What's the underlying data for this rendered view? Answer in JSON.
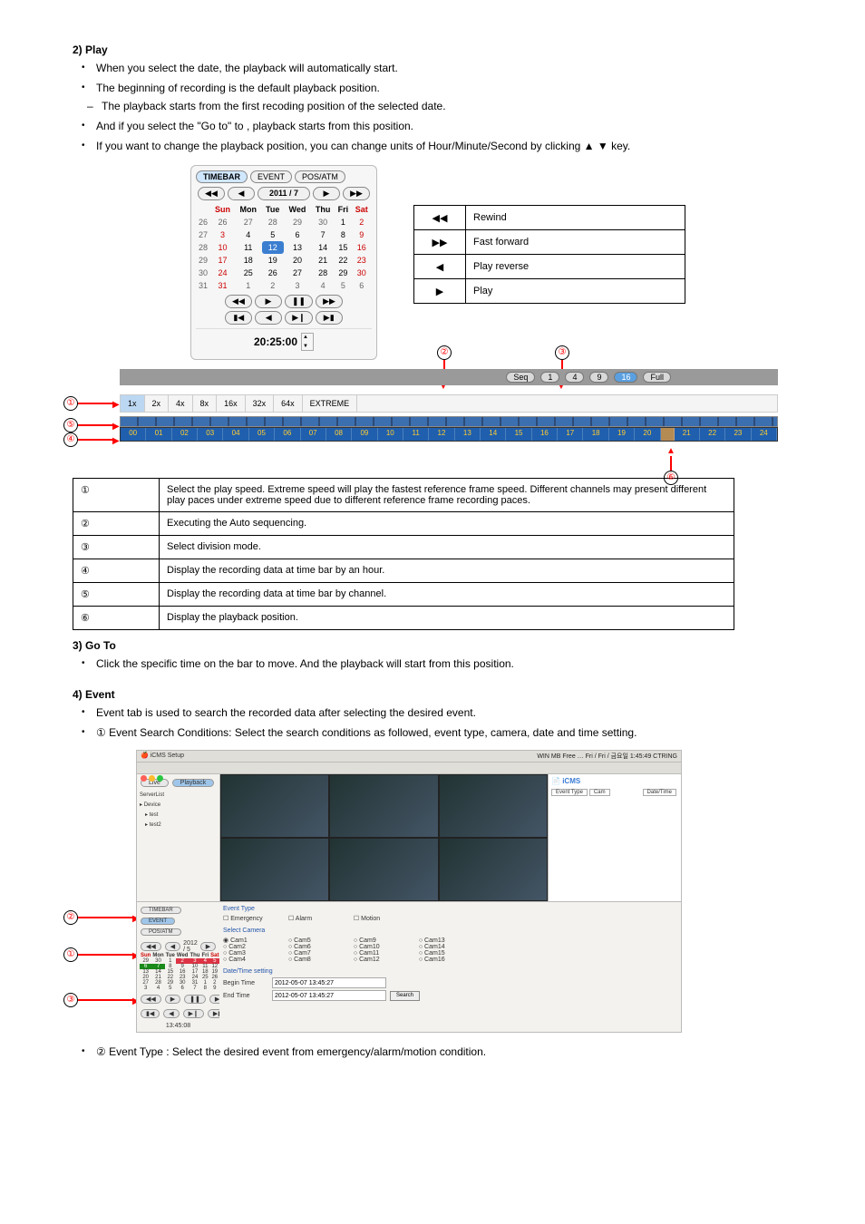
{
  "section1": {
    "title": "2) Play",
    "bullets": [
      "When you select the date, the playback will automatically start.",
      "The beginning of recording is the default playback position.",
      "If you want to change the playback position, you can change units of Hour/Minute/Second by clicking ▲ ▼ key."
    ],
    "subdashes": [
      "The playback starts from the first recoding position of the selected date.",
      "And if you select the \"Go to\" to , playback starts from this position."
    ]
  },
  "calendar": {
    "tabs": [
      "TIMEBAR",
      "EVENT",
      "POS/ATM"
    ],
    "yearMonth": "2011 / 7",
    "daysShort": [
      "Sun",
      "Mon",
      "Tue",
      "Wed",
      "Thu",
      "Fri",
      "Sat"
    ],
    "weeks": [
      {
        "wk": "26",
        "d": [
          "26",
          "27",
          "28",
          "29",
          "30",
          "1",
          "2"
        ]
      },
      {
        "wk": "27",
        "d": [
          "3",
          "4",
          "5",
          "6",
          "7",
          "8",
          "9"
        ]
      },
      {
        "wk": "28",
        "d": [
          "10",
          "11",
          "12",
          "13",
          "14",
          "15",
          "16"
        ]
      },
      {
        "wk": "29",
        "d": [
          "17",
          "18",
          "19",
          "20",
          "21",
          "22",
          "23"
        ]
      },
      {
        "wk": "30",
        "d": [
          "24",
          "25",
          "26",
          "27",
          "28",
          "29",
          "30"
        ]
      },
      {
        "wk": "31",
        "d": [
          "31",
          "1",
          "2",
          "3",
          "4",
          "5",
          "6"
        ]
      }
    ],
    "selectedDay": "12",
    "time": "20:25:00"
  },
  "legend": [
    {
      "icon": "◀◀",
      "label": "Rewind"
    },
    {
      "icon": "▶▶",
      "label": "Fast forward"
    },
    {
      "icon": "◀",
      "label": "Play reverse"
    },
    {
      "icon": "▶",
      "label": "Play"
    }
  ],
  "speedbar": {
    "divisions": [
      "Seq",
      "1",
      "4",
      "9",
      "16",
      "Full"
    ],
    "selectedDiv": "16",
    "speeds": [
      "1x",
      "2x",
      "4x",
      "8x",
      "16x",
      "32x",
      "64x",
      "EXTREME"
    ],
    "selectedSpeed": "1x",
    "hours": [
      "00",
      "01",
      "02",
      "03",
      "04",
      "05",
      "06",
      "07",
      "08",
      "09",
      "10",
      "11",
      "12",
      "13",
      "14",
      "15",
      "16",
      "17",
      "18",
      "19",
      "20",
      "21",
      "22",
      "23",
      "24"
    ]
  },
  "callouts": {
    "1": "①",
    "2": "②",
    "3": "③",
    "4": "④",
    "5": "⑤",
    "6": "⑥"
  },
  "sixtable": [
    {
      "n": "①",
      "desc": "Select the play speed. Extreme speed will play the fastest reference frame speed. Different channels may present different play paces under extreme speed due to different reference frame recording paces."
    },
    {
      "n": "②",
      "desc": "Executing the Auto sequencing."
    },
    {
      "n": "③",
      "desc": "Select division mode."
    },
    {
      "n": "④",
      "desc": "Display the recording data at time bar by an hour."
    },
    {
      "n": "⑤",
      "desc": "Display the recording data at time bar by channel."
    },
    {
      "n": "⑥",
      "desc": "Display the playback position."
    }
  ],
  "goto": {
    "title": "3) Go To",
    "bullet": "Click the specific time on the bar to move. And the playback will start from this position."
  },
  "event": {
    "title": "4) Event",
    "b1": "Event tab is used to search the recorded data after selecting the desired event.",
    "b2": "① Event Search Conditions: Select the search conditions as followed, event type, camera, date and time setting."
  },
  "shot": {
    "menubar": "iCMS   Setup",
    "topright": "WIN MB Free  …  Fri / Fri / 금요일   1:45:49   CTRING",
    "livebtn": "Live",
    "playbtn": "Playback",
    "serverlist": "ServerList",
    "devices": [
      "Device",
      "test",
      "test2"
    ],
    "right_title": "iCMS",
    "right_tabs": [
      "Event Type",
      "Cam",
      "",
      "Date/Time"
    ],
    "evt_title": "Event Type",
    "evts": [
      "Emergency",
      "Alarm",
      "Motion"
    ],
    "sel_title": "Select Camera",
    "cams": [
      "Cam1",
      "Cam2",
      "Cam3",
      "Cam4",
      "Cam5",
      "Cam6",
      "Cam7",
      "Cam8",
      "Cam9",
      "Cam10",
      "Cam11",
      "Cam12",
      "Cam13",
      "Cam14",
      "Cam15",
      "Cam16"
    ],
    "dt_title": "Date/Time setting",
    "begin_lbl": "Begin Time",
    "end_lbl": "End Time",
    "begin_val": "2012-05-07 13:45:27",
    "end_val": "2012-05-07 13:45:27",
    "search_btn": "Search",
    "lower_tabs": [
      "TIMEBAR",
      "EVENT",
      "POS/ATM"
    ],
    "minical_ym": "2012 / 5",
    "minical_days": [
      "Sun",
      "Mon",
      "Tue",
      "Wed",
      "Thu",
      "Fri",
      "Sat"
    ],
    "clock": "13:45:08"
  },
  "final_bullet": "② Event Type : Select the desired event from emergency/alarm/motion condition."
}
